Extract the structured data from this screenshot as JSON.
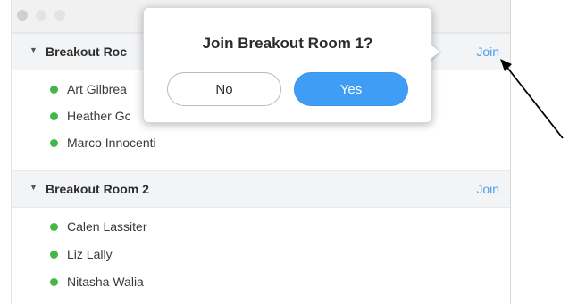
{
  "rooms": [
    {
      "name": "Breakout Room 1",
      "visible_name": "Breakout Roc",
      "join_label": "Join",
      "participants": [
        "Art Gilbrea",
        "Heather Gc",
        "Marco Innocenti"
      ]
    },
    {
      "name": "Breakout Room 2",
      "visible_name": "Breakout Room 2",
      "join_label": "Join",
      "participants": [
        "Calen Lassiter",
        "Liz Lally",
        "Nitasha Walia"
      ]
    }
  ],
  "dialog": {
    "title": "Join Breakout Room 1?",
    "no_label": "No",
    "yes_label": "Yes"
  },
  "colors": {
    "accent": "#3f9df5",
    "link": "#4a9fe8",
    "status_online": "#44b749"
  }
}
